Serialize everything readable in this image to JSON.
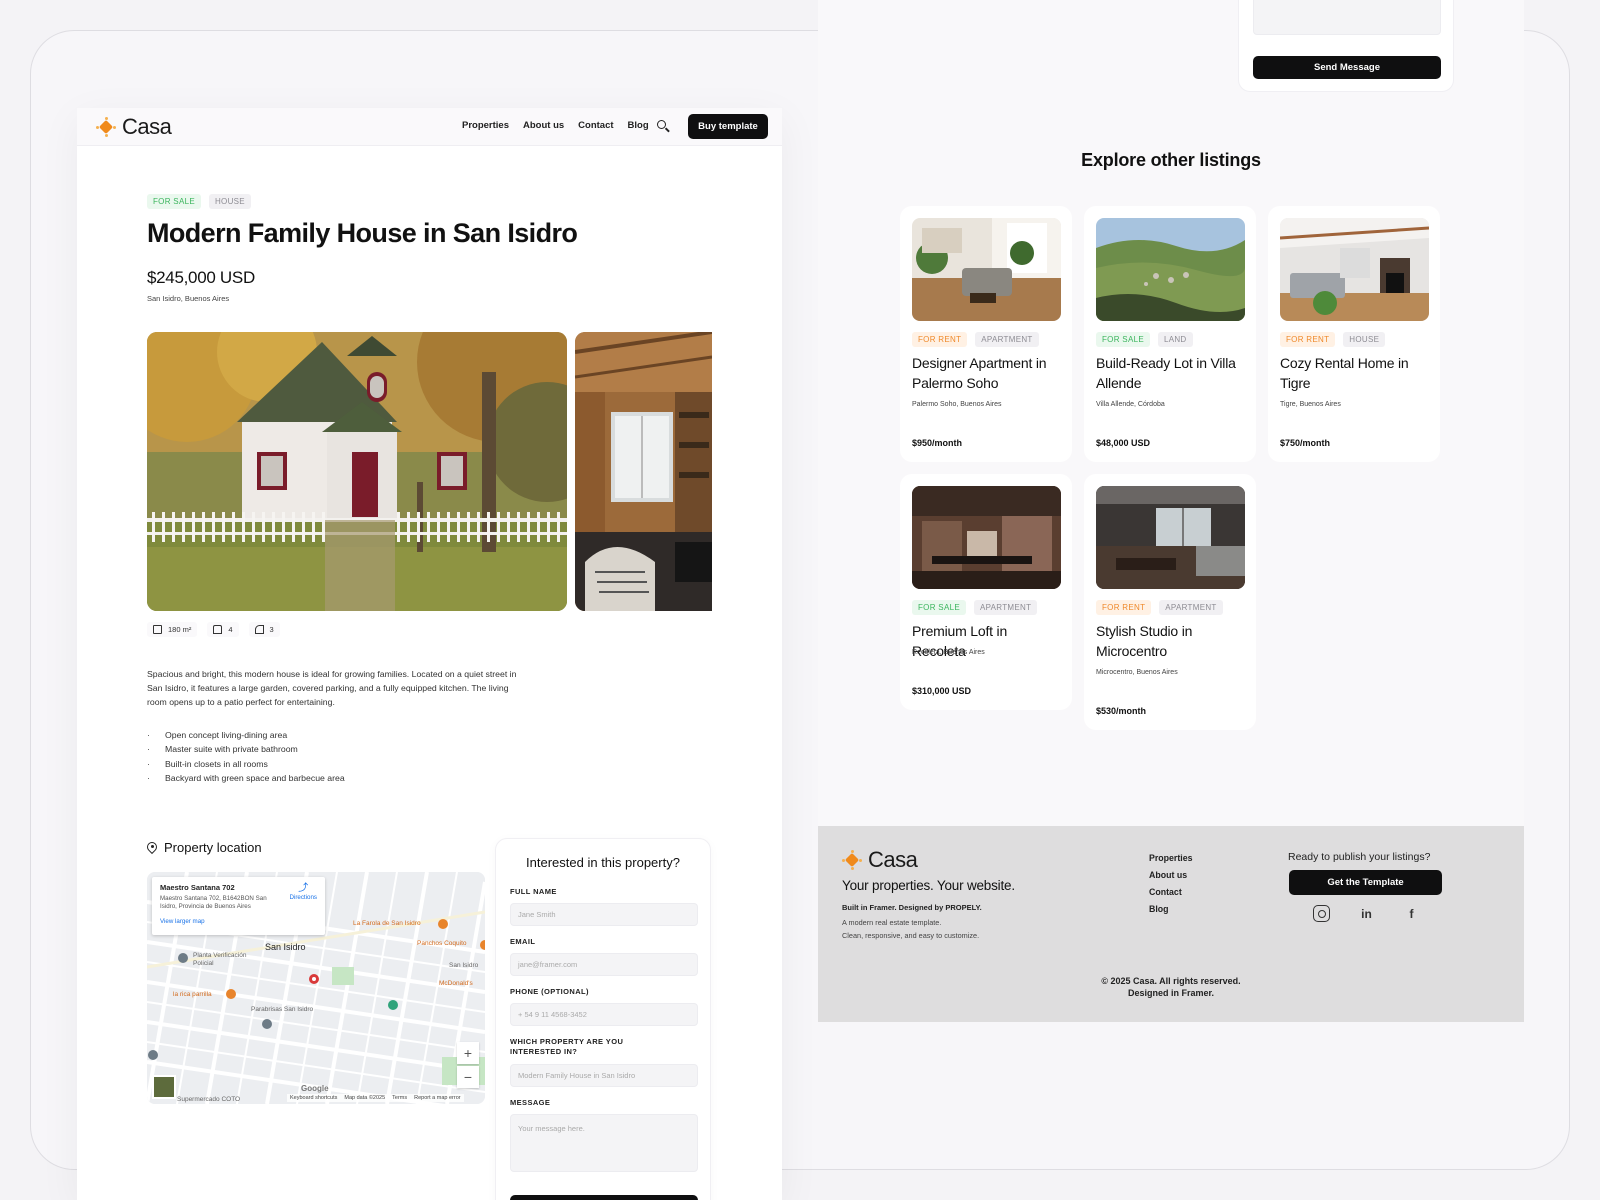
{
  "brand": {
    "name": "Casa",
    "accent": "#f08a1c"
  },
  "nav": {
    "links": [
      "Properties",
      "About us",
      "Contact",
      "Blog"
    ],
    "buy_label": "Buy template"
  },
  "property": {
    "status": "FOR SALE",
    "type": "HOUSE",
    "title": "Modern Family House in San Isidro",
    "price": "$245,000 USD",
    "location": "San Isidro, Buenos Aires",
    "features": {
      "area": "180 m²",
      "beds": "4",
      "baths": "3"
    },
    "description": "Spacious and bright, this modern house is ideal for growing families. Located on a quiet street in San Isidro, it features a large garden, covered parking, and a fully equipped kitchen. The living room opens up to a patio perfect for entertaining.",
    "highlights": [
      "Open concept living-dining area",
      "Master suite with private bathroom",
      "Built-in closets in all rooms",
      "Backyard with green space and barbecue area"
    ]
  },
  "location_section": {
    "heading": "Property location",
    "map": {
      "card_title": "Maestro Santana 702",
      "card_address": "Maestro Santana 702, B1642BON San Isidro, Provincia de Buenos Aires",
      "larger_map": "View larger map",
      "directions": "Directions",
      "labels": {
        "san_isidro": "San Isidro",
        "san_isidro_small": "San Isidro",
        "farola": "La Farola de San Isidro",
        "planta": "Planta Verificación Policial",
        "panchos": "Panchos Coquito",
        "mcdonalds": "McDonald's",
        "parrilla": "la rica parrilla",
        "parabrisas": "Parabrisas San Isidro",
        "supermercado": "Supermercado COTO"
      },
      "footer": [
        "Keyboard shortcuts",
        "Map data ©2025",
        "Terms",
        "Report a map error"
      ],
      "google": "Google"
    }
  },
  "inquiry_form": {
    "title": "Interested in this property?",
    "full_name_label": "FULL NAME",
    "full_name_placeholder": "Jane Smith",
    "email_label": "EMAIL",
    "email_placeholder": "jane@framer.com",
    "phone_label": "PHONE (OPTIONAL)",
    "phone_placeholder": "+ 54 9 11 4568-3452",
    "property_label": "WHICH PROPERTY ARE YOU INTERESTED IN?",
    "property_placeholder": "Modern Family House in San Isidro",
    "message_label": "MESSAGE",
    "message_placeholder": "Your message here.",
    "send_label": "Send Message"
  },
  "explore": {
    "heading": "Explore other listings",
    "listings": [
      {
        "status": "FOR RENT",
        "type": "APARTMENT",
        "title": "Designer Apartment in Palermo Soho",
        "location": "Palermo Soho, Buenos Aires",
        "price": "$950/month"
      },
      {
        "status": "FOR SALE",
        "type": "LAND",
        "title": "Build-Ready Lot in Villa Allende",
        "location": "Villa Allende, Córdoba",
        "price": "$48,000 USD"
      },
      {
        "status": "FOR RENT",
        "type": "HOUSE",
        "title": "Cozy Rental Home in Tigre",
        "location": "Tigre, Buenos Aires",
        "price": "$750/month"
      },
      {
        "status": "FOR SALE",
        "type": "APARTMENT",
        "title": "Premium Loft in Recoleta",
        "location": "Recoleta, Buenos Aires",
        "price": "$310,000 USD"
      },
      {
        "status": "FOR RENT",
        "type": "APARTMENT",
        "title": "Stylish Studio in Microcentro",
        "location": "Microcentro, Buenos Aires",
        "price": "$530/month"
      }
    ]
  },
  "footer": {
    "tagline": "Your properties. Your website.",
    "built": "Built in Framer. Designed by PROPELY.",
    "sub1": "A modern real estate template.",
    "sub2": "Clean, responsive, and easy to customize.",
    "links": [
      "Properties",
      "About us",
      "Contact",
      "Blog"
    ],
    "ready": "Ready to publish your listings?",
    "cta": "Get the Template",
    "social_icons": [
      "instagram-icon",
      "linkedin-icon",
      "facebook-icon"
    ],
    "copyright1": "© 2025 Casa. All rights reserved.",
    "copyright2": "Designed in Framer."
  }
}
